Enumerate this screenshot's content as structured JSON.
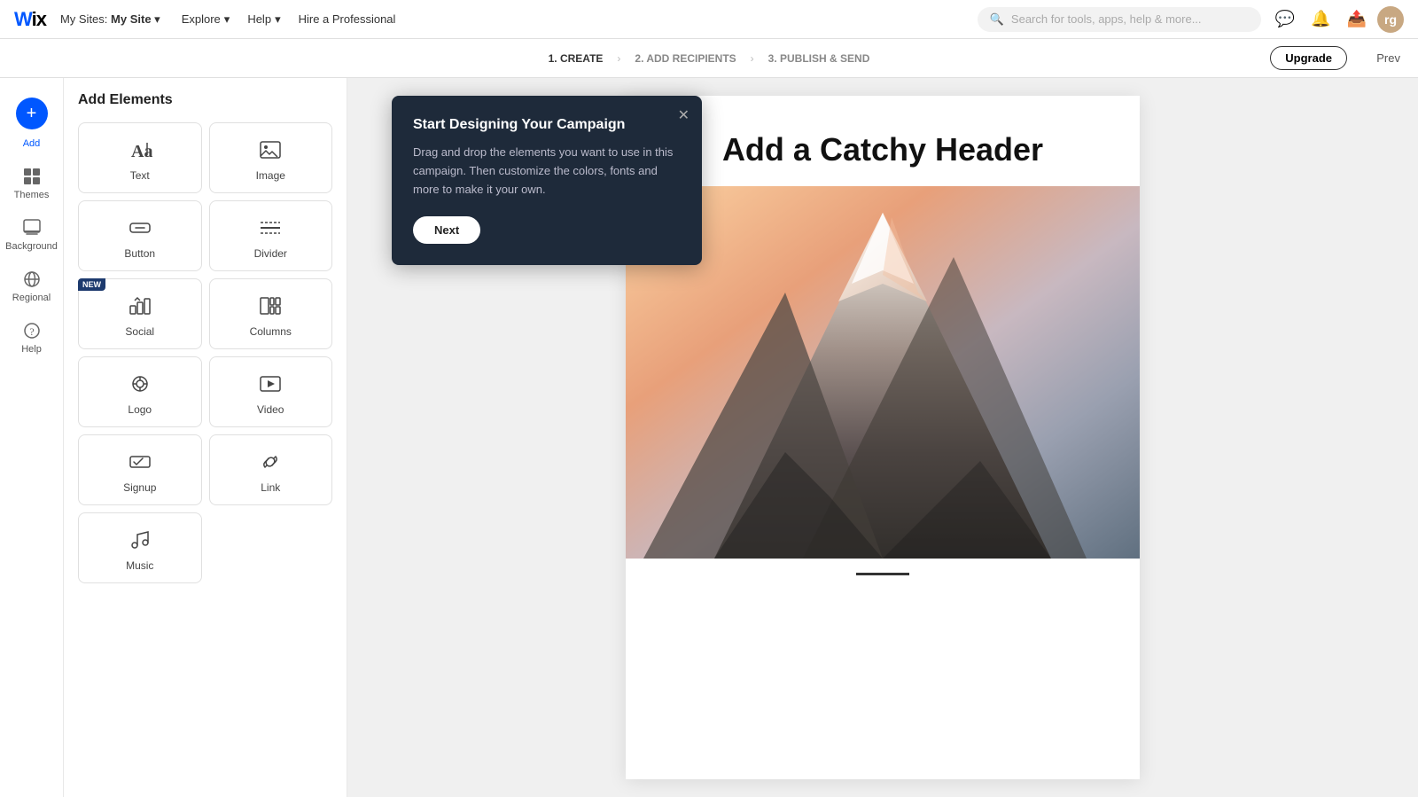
{
  "topnav": {
    "logo": "Wix",
    "my_sites": "My Sites:",
    "site_name": "My Site",
    "explore": "Explore",
    "help": "Help",
    "hire": "Hire a Professional",
    "search_placeholder": "Search for tools, apps, help & more..."
  },
  "steps": {
    "step1": "1. CREATE",
    "step2": "2. ADD RECIPIENTS",
    "step3": "3. PUBLISH & SEND",
    "upgrade": "Upgrade",
    "prev": "Prev"
  },
  "sidebar": {
    "add_label": "Add",
    "themes_label": "Themes",
    "background_label": "Background",
    "regional_label": "Regional",
    "help_label": "Help"
  },
  "add_panel": {
    "title": "Add Elements",
    "elements": [
      {
        "id": "text",
        "label": "Text",
        "icon": "text"
      },
      {
        "id": "image",
        "label": "Image",
        "icon": "image"
      },
      {
        "id": "button",
        "label": "Button",
        "icon": "button"
      },
      {
        "id": "divider",
        "label": "Divider",
        "icon": "divider"
      },
      {
        "id": "social",
        "label": "Social",
        "icon": "social",
        "badge": "NEW"
      },
      {
        "id": "columns",
        "label": "Columns",
        "icon": "columns"
      },
      {
        "id": "logo",
        "label": "Logo",
        "icon": "logo"
      },
      {
        "id": "video",
        "label": "Video",
        "icon": "video"
      },
      {
        "id": "signup",
        "label": "Signup",
        "icon": "signup"
      },
      {
        "id": "link",
        "label": "Link",
        "icon": "link"
      },
      {
        "id": "music",
        "label": "Music",
        "icon": "music"
      }
    ]
  },
  "canvas": {
    "header": "Add a Catchy Header"
  },
  "tooltip": {
    "title": "Start Designing Your Campaign",
    "body": "Drag and drop the elements you want to use in this campaign. Then customize the colors, fonts and more to make it your own.",
    "next_label": "Next"
  }
}
